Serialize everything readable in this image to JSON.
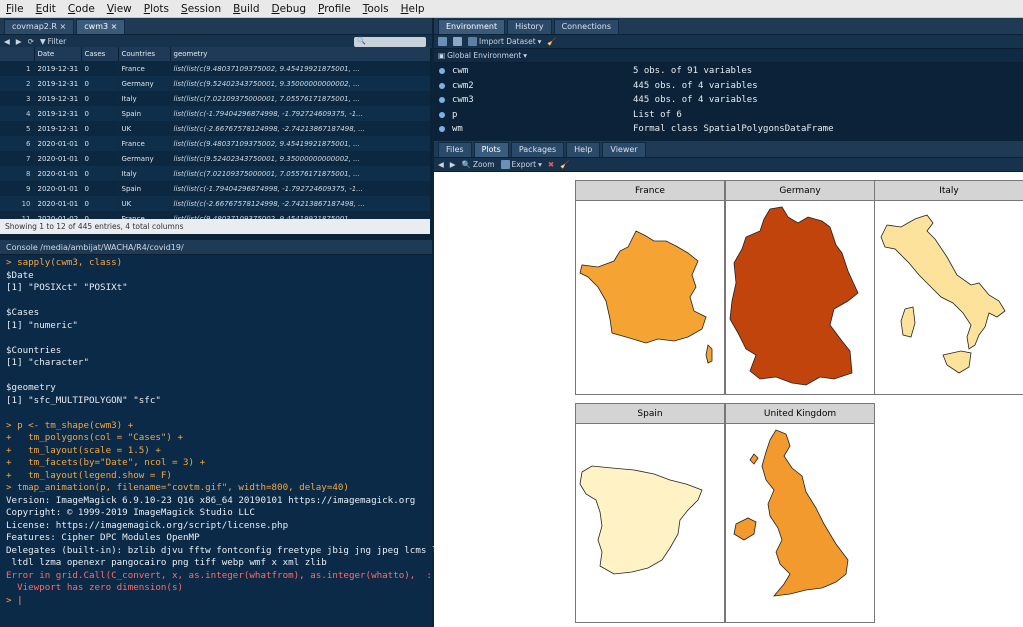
{
  "menubar": [
    "File",
    "Edit",
    "Code",
    "View",
    "Plots",
    "Session",
    "Build",
    "Debug",
    "Profile",
    "Tools",
    "Help"
  ],
  "editor": {
    "tabs": [
      "covmap2.R",
      "cwm3"
    ],
    "filter_label": "Filter",
    "columns": [
      "Date",
      "Cases",
      "Countries",
      "geometry"
    ],
    "rows": [
      [
        "1",
        "2019-12-31",
        "0",
        "France",
        "list(list(c(9.48037109375002, 9.45419921875001, ..."
      ],
      [
        "2",
        "2019-12-31",
        "0",
        "Germany",
        "list(list(c(9.52402343750001, 9.35000000000002, ..."
      ],
      [
        "3",
        "2019-12-31",
        "0",
        "Italy",
        "list(list(c(7.02109375000001, 7.05576171875001, ..."
      ],
      [
        "4",
        "2019-12-31",
        "0",
        "Spain",
        "list(list(c(-1.79404296874998, -1.792724609375, -1..."
      ],
      [
        "5",
        "2019-12-31",
        "0",
        "UK",
        "list(list(c(-2.66767578124998, -2.74213867187498, ..."
      ],
      [
        "6",
        "2020-01-01",
        "0",
        "France",
        "list(list(c(9.48037109375002, 9.45419921875001, ..."
      ],
      [
        "7",
        "2020-01-01",
        "0",
        "Germany",
        "list(list(c(9.52402343750001, 9.35000000000002, ..."
      ],
      [
        "8",
        "2020-01-01",
        "0",
        "Italy",
        "list(list(c(7.02109375000001, 7.05576171875001, ..."
      ],
      [
        "9",
        "2020-01-01",
        "0",
        "Spain",
        "list(list(c(-1.79404296874998, -1.792724609375, -1..."
      ],
      [
        "10",
        "2020-01-01",
        "0",
        "UK",
        "list(list(c(-2.66767578124998, -2.74213867187498, ..."
      ],
      [
        "11",
        "2020-01-02",
        "0",
        "France",
        "list(list(c(9.48037109375002, 9.45419921875001, ..."
      ]
    ],
    "footer": "Showing 1 to 12 of 445 entries, 4 total columns"
  },
  "console": {
    "header": "Console  /media/ambijat/WACHA/R4/covid19/",
    "lines": [
      {
        "t": "> sapply(cwm3, class)",
        "c": "cmd"
      },
      {
        "t": "$Date",
        "c": ""
      },
      {
        "t": "[1] \"POSIXct\" \"POSIXt\"",
        "c": ""
      },
      {
        "t": "",
        "c": ""
      },
      {
        "t": "$Cases",
        "c": ""
      },
      {
        "t": "[1] \"numeric\"",
        "c": ""
      },
      {
        "t": "",
        "c": ""
      },
      {
        "t": "$Countries",
        "c": ""
      },
      {
        "t": "[1] \"character\"",
        "c": ""
      },
      {
        "t": "",
        "c": ""
      },
      {
        "t": "$geometry",
        "c": ""
      },
      {
        "t": "[1] \"sfc_MULTIPOLYGON\" \"sfc\"",
        "c": ""
      },
      {
        "t": "",
        "c": ""
      },
      {
        "t": "> p <- tm_shape(cwm3) +",
        "c": "cmd"
      },
      {
        "t": "+   tm_polygons(col = \"Cases\") +",
        "c": "cmd"
      },
      {
        "t": "+   tm_layout(scale = 1.5) +",
        "c": "cmd"
      },
      {
        "t": "+   tm_facets(by=\"Date\", ncol = 3) +",
        "c": "cmd"
      },
      {
        "t": "+   tm_layout(legend.show = F)",
        "c": "cmd"
      },
      {
        "t": "> tmap_animation(p, filename=\"covtm.gif\", width=800, delay=40)",
        "c": "cmd"
      },
      {
        "t": "Version: ImageMagick 6.9.10-23 Q16 x86_64 20190101 https://imagemagick.org",
        "c": ""
      },
      {
        "t": "Copyright: © 1999-2019 ImageMagick Studio LLC",
        "c": ""
      },
      {
        "t": "License: https://imagemagick.org/script/license.php",
        "c": ""
      },
      {
        "t": "Features: Cipher DPC Modules OpenMP",
        "c": ""
      },
      {
        "t": "Delegates (built-in): bzlib djvu fftw fontconfig freetype jbig jng jpeg lcms lqr",
        "c": ""
      },
      {
        "t": " ltdl lzma openexr pangocairo png tiff webp wmf x xml zlib",
        "c": ""
      },
      {
        "t": "Error in grid.Call(C_convert, x, as.integer(whatfrom), as.integer(whatto),  :",
        "c": "err"
      },
      {
        "t": "  Viewport has zero dimension(s)",
        "c": "err"
      },
      {
        "t": "> |",
        "c": "cmd"
      }
    ]
  },
  "environment": {
    "tabs": [
      "Environment",
      "History",
      "Connections"
    ],
    "import_label": "Import Dataset",
    "scope_label": "Global Environment",
    "items": [
      {
        "name": "cwm",
        "value": "5 obs. of 91 variables"
      },
      {
        "name": "cwm2",
        "value": "445 obs. of 4 variables"
      },
      {
        "name": "cwm3",
        "value": "445 obs. of 4 variables"
      },
      {
        "name": "p",
        "value": "List of 6"
      },
      {
        "name": "wm",
        "value": "Formal class SpatialPolygonsDataFrame"
      }
    ]
  },
  "plots": {
    "tabs": [
      "Files",
      "Plots",
      "Packages",
      "Help",
      "Viewer"
    ],
    "zoom_label": "Zoom",
    "export_label": "Export",
    "facets": [
      {
        "title": "France",
        "fill": "#f5a332"
      },
      {
        "title": "Germany",
        "fill": "#c0440c"
      },
      {
        "title": "Italy",
        "fill": "#fde29b"
      },
      {
        "title": "Spain",
        "fill": "#fff2c5"
      },
      {
        "title": "United Kingdom",
        "fill": "#f29a2e"
      }
    ]
  }
}
